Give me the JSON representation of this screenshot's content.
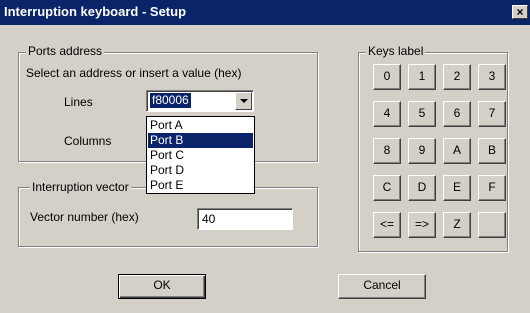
{
  "window": {
    "title": "Interruption keyboard - Setup",
    "close_glyph": "×"
  },
  "ports": {
    "group_label": "Ports address",
    "instruction": "Select an address or insert a value (hex)",
    "lines_label": "Lines",
    "lines_value": "f80006",
    "columns_label": "Columns",
    "options": [
      "Port A",
      "Port B",
      "Port C",
      "Port D",
      "Port E"
    ],
    "selected_option": "Port B"
  },
  "vector": {
    "group_label": "Interruption vector",
    "number_label": "Vector number (hex)",
    "number_value": "40"
  },
  "keys": {
    "group_label": "Keys label",
    "labels": [
      "0",
      "1",
      "2",
      "3",
      "4",
      "5",
      "6",
      "7",
      "8",
      "9",
      "A",
      "B",
      "C",
      "D",
      "E",
      "F",
      "<=",
      "=>",
      "Z",
      ""
    ]
  },
  "buttons": {
    "ok": "OK",
    "cancel": "Cancel"
  }
}
